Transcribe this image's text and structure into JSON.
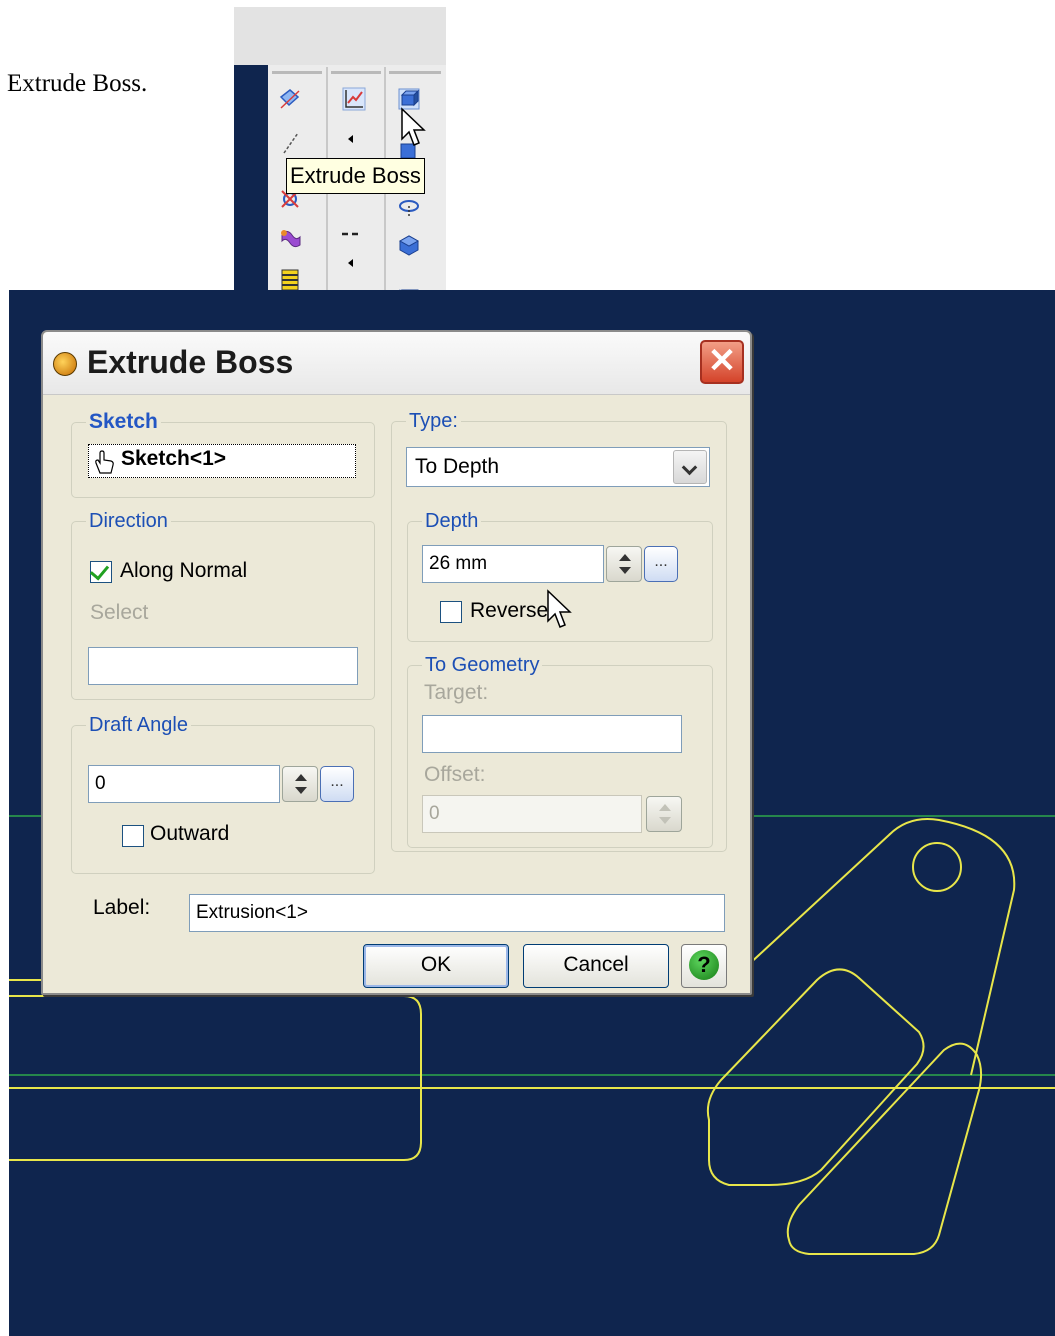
{
  "caption": "Extrude Boss.",
  "toolbar": {
    "tooltip": "Extrude Boss"
  },
  "dialog": {
    "title": "Extrude Boss",
    "sketch": {
      "legend": "Sketch",
      "value": "Sketch<1>"
    },
    "direction": {
      "legend": "Direction",
      "along_normal_label": "Along Normal",
      "along_normal_checked": true,
      "select_label": "Select",
      "select_value": ""
    },
    "draft_angle": {
      "legend": "Draft Angle",
      "value": "0",
      "outward_label": "Outward",
      "outward_checked": false
    },
    "type": {
      "legend": "Type:",
      "value": "To Depth"
    },
    "depth": {
      "legend": "Depth",
      "value": "26 mm",
      "reverse_label": "Reverse",
      "reverse_checked": false
    },
    "to_geometry": {
      "legend": "To Geometry",
      "target_label": "Target:",
      "target_value": "",
      "offset_label": "Offset:",
      "offset_value": "0"
    },
    "label_field": {
      "label": "Label:",
      "value": "Extrusion<1>"
    },
    "buttons": {
      "ok": "OK",
      "cancel": "Cancel",
      "help": "?"
    }
  },
  "colors": {
    "viewport_bg": "#0f254e",
    "sketch_line": "#e8e64a",
    "axis_line": "#2fa84a",
    "point": "#1fd2e0"
  }
}
